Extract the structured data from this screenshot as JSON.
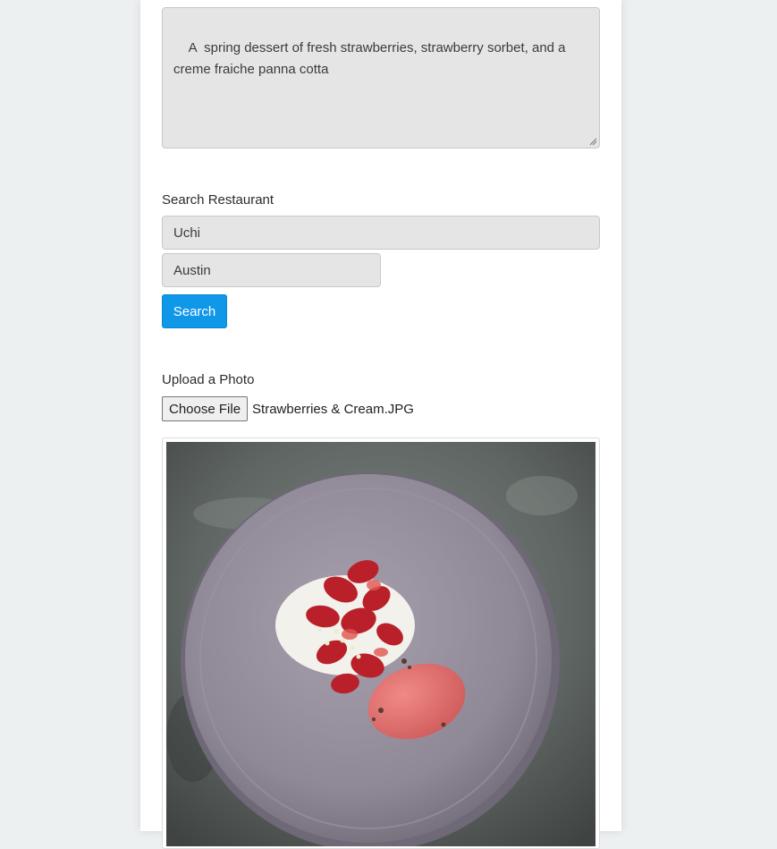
{
  "description": {
    "text": "A  spring dessert of fresh strawberries, strawberry sorbet, and a creme fraiche panna cotta"
  },
  "search": {
    "label": "Search Restaurant",
    "restaurant_value": "Uchi",
    "city_value": "Austin",
    "button_label": "Search"
  },
  "upload": {
    "label": "Upload a Photo",
    "choose_label": "Choose File",
    "file_name": "Strawberries & Cream.JPG"
  },
  "colors": {
    "page_bg": "#ecf0f1",
    "input_bg": "#e5e5e5",
    "primary": "#0f97e8"
  }
}
